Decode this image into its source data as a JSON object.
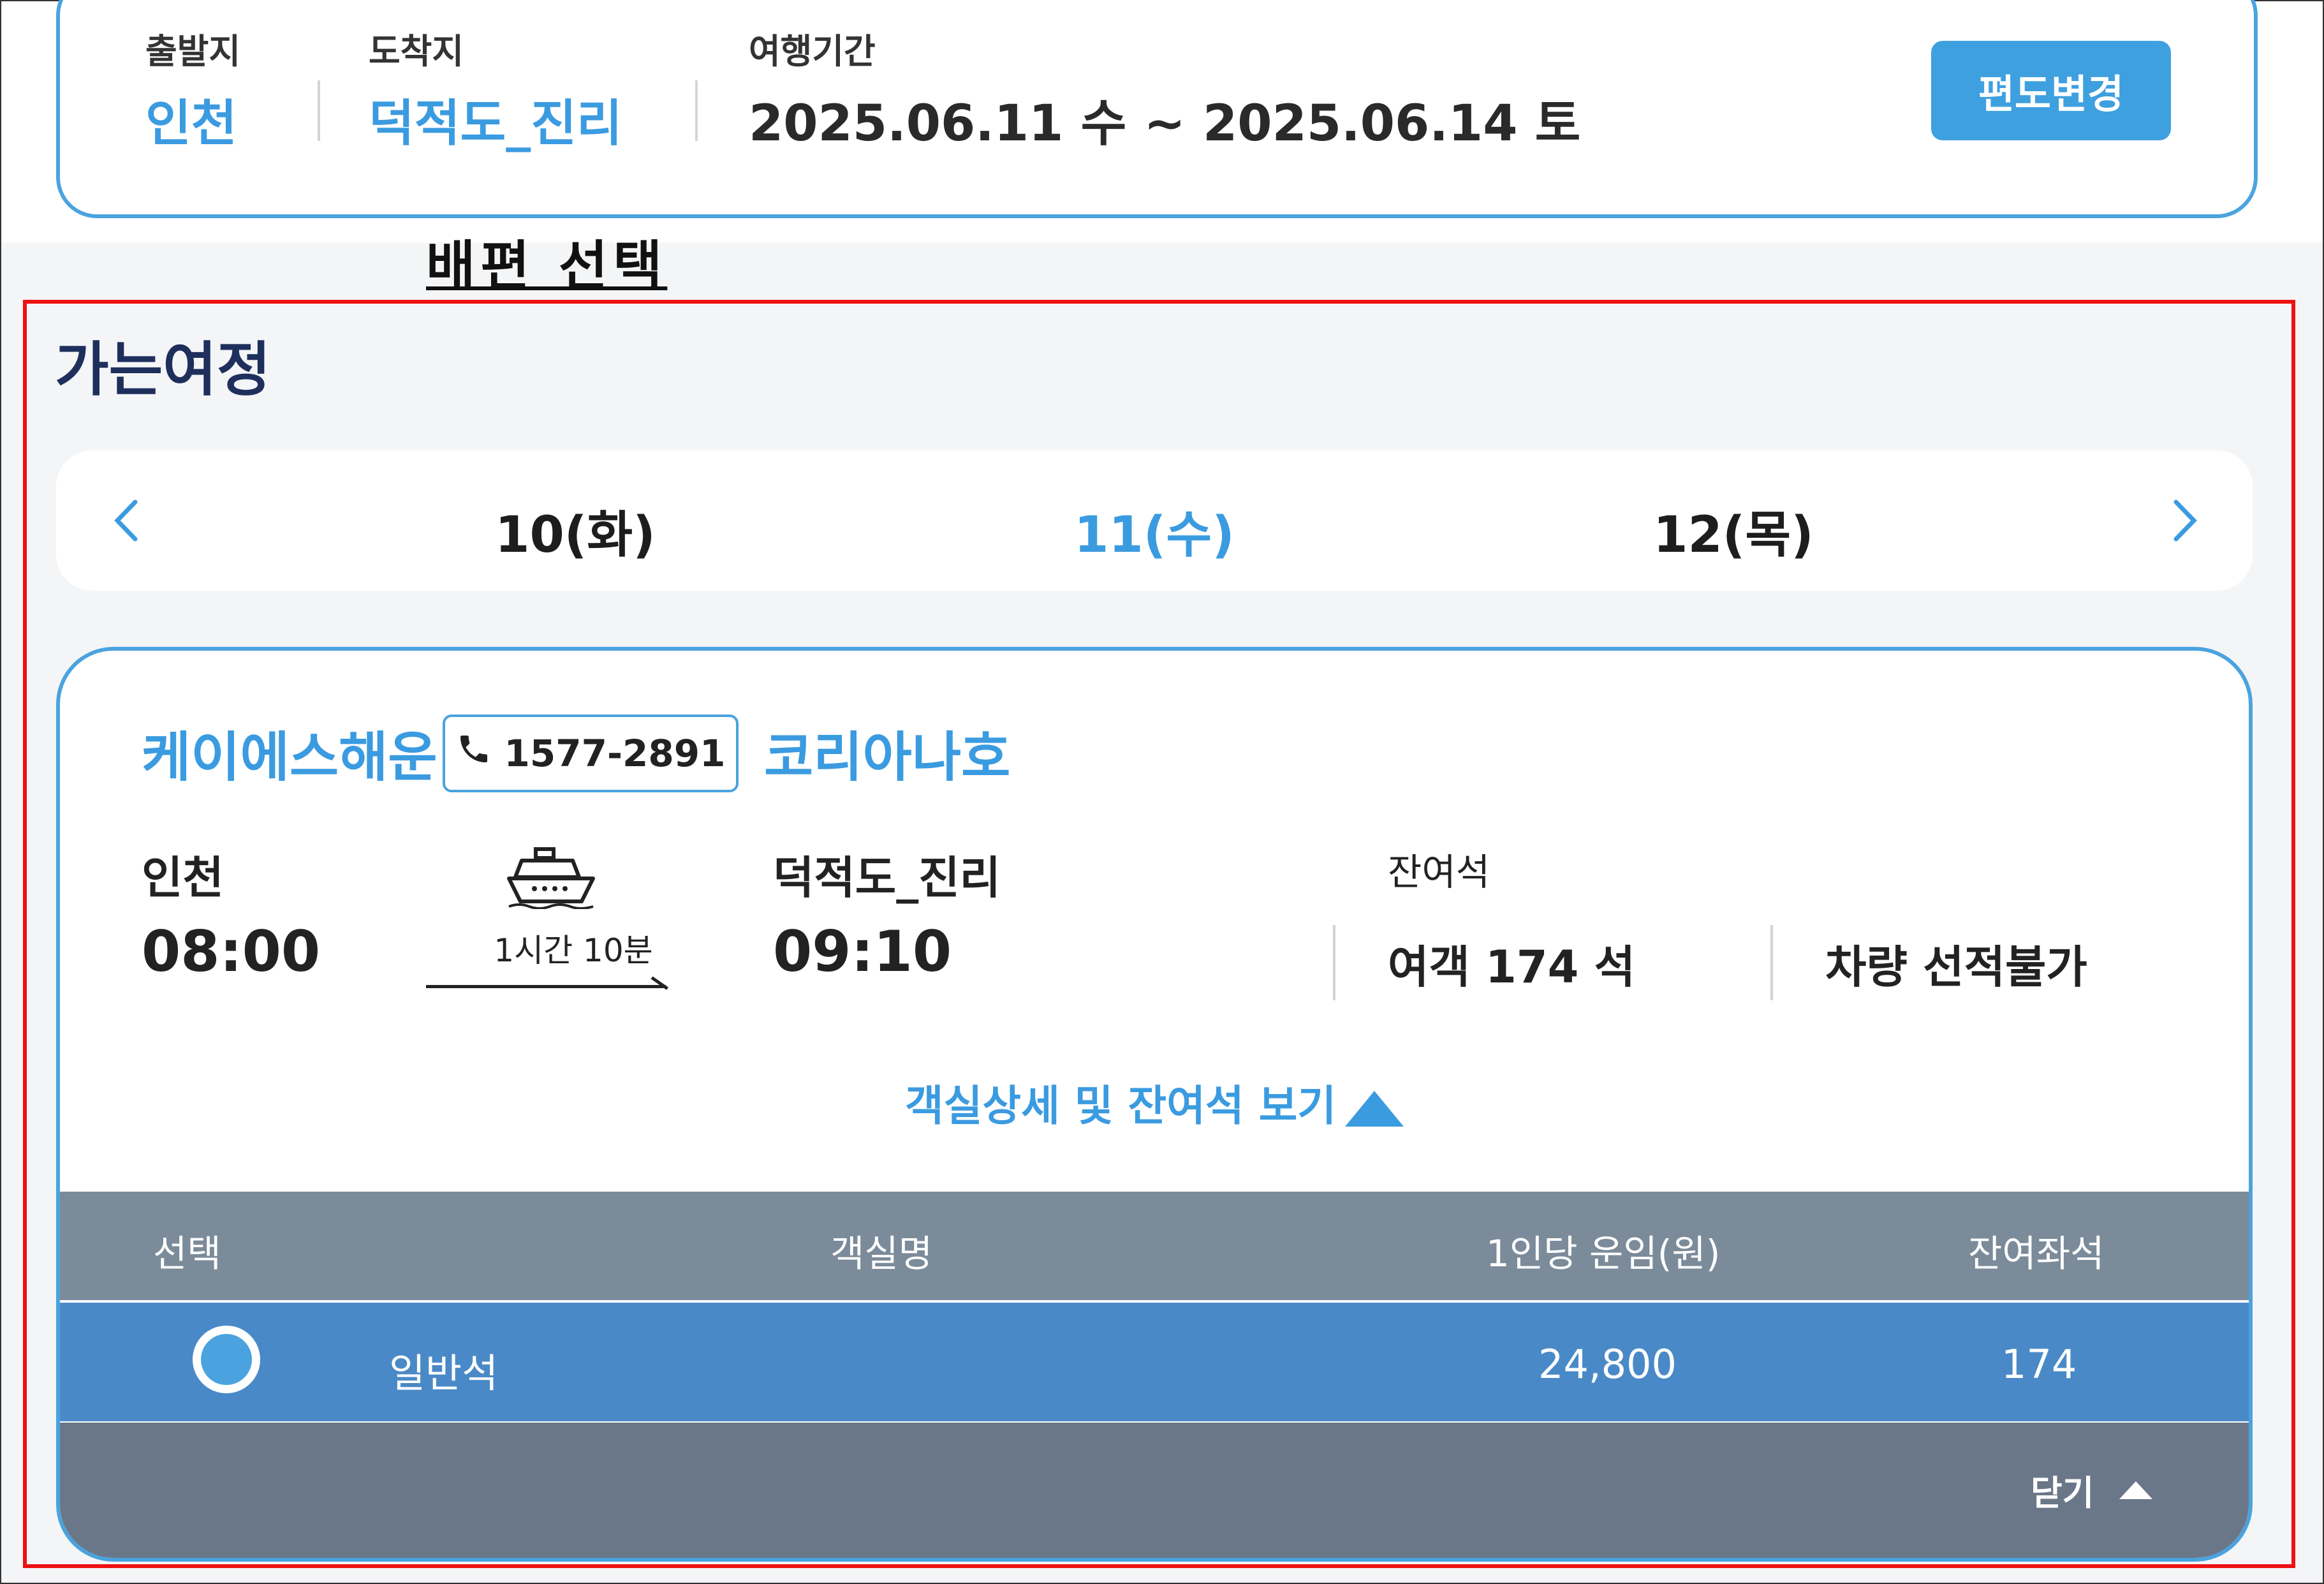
{
  "search": {
    "origin_label": "출발지",
    "origin_value": "인천",
    "destination_label": "도착지",
    "destination_value": "덕적도_진리",
    "period_label": "여행기간",
    "period_value": "2025.06.11 수 ~ 2025.06.14 토",
    "change_button": "편도변경"
  },
  "section_title": "배편 선택",
  "journey_title": "가는여정",
  "dates": {
    "prev_icon": "chevron-left-icon",
    "next_icon": "chevron-right-icon",
    "items": [
      {
        "label": "10(화)",
        "active": false
      },
      {
        "label": "11(수)",
        "active": true
      },
      {
        "label": "12(목)",
        "active": false
      }
    ]
  },
  "ferry": {
    "company": "케이에스해운",
    "phone": "1577-2891",
    "ship_name": "코리아나호",
    "departure_port": "인천",
    "departure_time": "08:00",
    "duration": "1시간 10분",
    "arrival_port": "덕적도_진리",
    "arrival_time": "09:10",
    "remaining_label": "잔여석",
    "passenger_seats": "여객 174 석",
    "vehicle_seats": "차량 선적불가",
    "detail_link": "객실상세 및 잔여석 보기",
    "table": {
      "headers": [
        "선택",
        "객실명",
        "1인당 운임(원)",
        "잔여좌석"
      ],
      "rows": [
        {
          "name": "일반석",
          "fare": "24,800",
          "seats": "174",
          "selected": true
        }
      ]
    },
    "close_label": "닫기"
  },
  "colors": {
    "accent": "#3b9be0",
    "highlight_box": "#ee1111",
    "table_header": "#7b8b9a",
    "selected_row": "#4a89c7",
    "footer": "#6a7788"
  }
}
